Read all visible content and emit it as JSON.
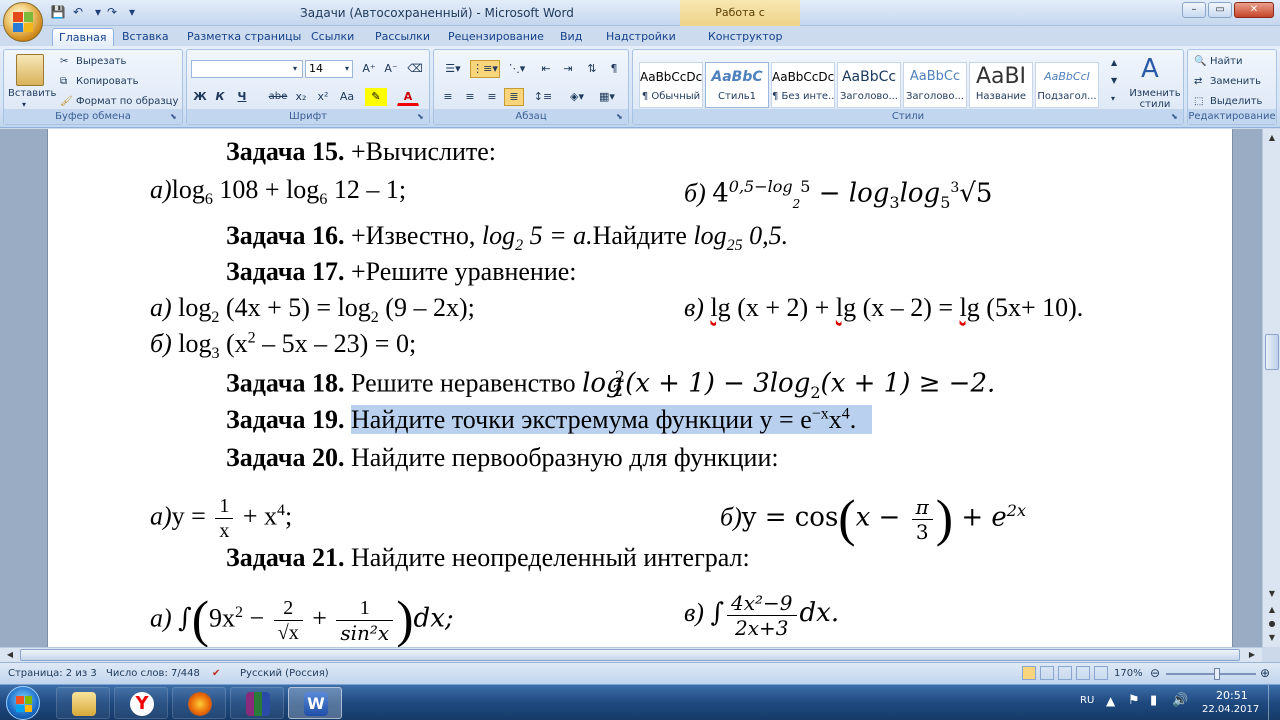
{
  "window": {
    "title": "Задачи (Автосохраненный) - Microsoft Word",
    "context_tab_title": "Работа с формулами",
    "minimize": "–",
    "restore": "▭",
    "close": "✕"
  },
  "qat": {
    "save": "💾",
    "undo": "↶",
    "redo": "↷",
    "more": "▾"
  },
  "tabs": [
    "Главная",
    "Вставка",
    "Разметка страницы",
    "Ссылки",
    "Рассылки",
    "Рецензирование",
    "Вид",
    "Надстройки",
    "Конструктор"
  ],
  "ribbon": {
    "clipboard": {
      "label": "Буфер обмена",
      "paste": "Вставить",
      "cut": "Вырезать",
      "copy": "Копировать",
      "format_painter": "Формат по образцу"
    },
    "font": {
      "label": "Шрифт",
      "font_name": "",
      "font_size": "14",
      "bold": "Ж",
      "italic": "К",
      "underline": "Ч",
      "strike": "abe",
      "subscript": "x₂",
      "superscript": "x²",
      "change_case": "Aa",
      "grow": "A⁺",
      "shrink": "A⁻",
      "font_color": "A"
    },
    "paragraph": {
      "label": "Абзац"
    },
    "styles": {
      "label": "Стили",
      "items": [
        {
          "preview": "AaBbCcDc",
          "name": "¶ Обычный"
        },
        {
          "preview": "AaBbC",
          "name": "Стиль1"
        },
        {
          "preview": "AaBbCcDc",
          "name": "¶ Без инте..."
        },
        {
          "preview": "AaBbCc",
          "name": "Заголово..."
        },
        {
          "preview": "AaBbCc",
          "name": "Заголово..."
        },
        {
          "preview": "AaBI",
          "name": "Название"
        },
        {
          "preview": "AaBbCcI",
          "name": "Подзагол..."
        }
      ],
      "change_styles": "Изменить стили"
    },
    "editing": {
      "label": "Редактирование",
      "find": "Найти",
      "replace": "Заменить",
      "select": "Выделить"
    }
  },
  "doc": {
    "z15": {
      "title": "Задача 15.",
      "text": "+Вычислите:"
    },
    "z15a": {
      "prefix": "а)",
      "log1": "log",
      "sub1": "6",
      "n1": " 108 + ",
      "log2": "log",
      "sub2": "6",
      "rest": " 12 – 1;"
    },
    "z15b": {
      "prefix": "б) ",
      "base": "4",
      "exp": "0,5−log",
      "expsub": "2",
      "exp2": "5",
      "minus": " − log",
      "s3": "3",
      "log5": "log",
      "s5": "5",
      "root_idx": "3",
      "root": "√5"
    },
    "z16": {
      "title": "Задача 16.",
      "t1": "+Известно, ",
      "t2": "log",
      "t2sub": "2",
      "t3": " 5 = a.",
      "t4": "Найдите ",
      "t5": "log",
      "t5sub": "25",
      "t6": " 0,5."
    },
    "z17": {
      "title": "Задача 17.",
      "text": "+Решите уравнение:"
    },
    "z17a": {
      "prefix": "а) ",
      "l1": "log",
      "s1": "2",
      "m1": " (4x + 5) = ",
      "l2": "log",
      "s2": "2",
      "m2": " (9 – 2x);"
    },
    "z17v": {
      "prefix": "в) ",
      "l1": "lg",
      "m1": " (x + 2) + ",
      "l2": "lg",
      "m2": " (x – 2) = ",
      "l3": "lg",
      "m3": " (5x+ 10)."
    },
    "z17b": {
      "prefix": "б) ",
      "l1": "log",
      "s1": "3",
      "m1": " (x",
      "p1": "2",
      "m2": " – 5x – 23) = 0;"
    },
    "z18": {
      "title": "Задача 18.",
      "t1": "Решите неравенство ",
      "l1": "log",
      "s1": "2",
      "p1": "2",
      "m1": "(x + 1) − 3log",
      "s2": "2",
      "m2": "(x + 1) ≥ −2."
    },
    "z19": {
      "title": "Задача 19.",
      "t1": "Найдите точки экстремума функции y = e",
      "p1": "−x",
      "m1": "x",
      "p2": "4",
      "m2": "."
    },
    "z20": {
      "title": "Задача 20.",
      "text": "Найдите первообразную для функции:"
    },
    "z20a": {
      "prefix": "а)",
      "y": "y = ",
      "num": "1",
      "den": "x",
      "rest": " + x",
      "p": "4",
      "end": ";"
    },
    "z20b": {
      "prefix": "б)",
      "y": "y = cos",
      "lp": "(",
      "x": "x − ",
      "num": "π",
      "den": "3",
      "rp": ")",
      "plus": " + e",
      "p": "2x"
    },
    "z21": {
      "title": "Задача 21.",
      "text": "Найдите неопределенный интеграл:"
    },
    "z21a": {
      "prefix": "а) ",
      "int": "∫",
      "lp": "(",
      "t1": "9x",
      "p1": "2",
      "minus": " − ",
      "num1": "2",
      "den1": "√x",
      "plus": " + ",
      "num2": "1",
      "den2": "sin²x",
      "rp": ")",
      "dx": "dx;"
    },
    "z21v": {
      "prefix": "в) ",
      "int": "∫",
      "num": "4x²−9",
      "den": "2x+3",
      "dx": "dx."
    }
  },
  "status": {
    "page": "Страница: 2 из 3",
    "words": "Число слов: 7/448",
    "lang": "Русский (Россия)",
    "zoom": "170%"
  },
  "taskbar": {
    "lang": "RU",
    "time": "20:51",
    "date": "22.04.2017"
  },
  "colors": {
    "ribbon_text": "#15428b",
    "selection": "#b9d1ee",
    "taskbar": "#1f4a80"
  }
}
